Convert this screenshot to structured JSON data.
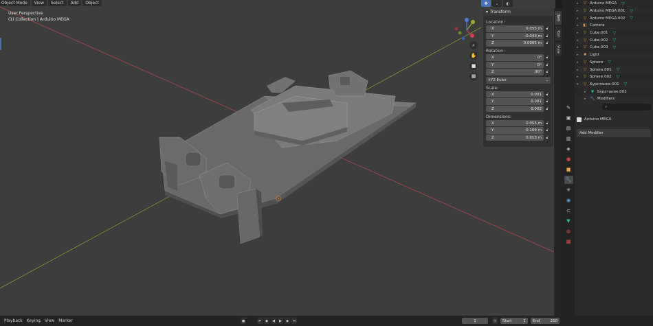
{
  "header": {
    "mode": "Object Mode",
    "menus": [
      "View",
      "Select",
      "Add",
      "Object"
    ]
  },
  "viewport": {
    "perspective": "User Perspective",
    "collection": "(1) Collection | Arduino MEGA"
  },
  "npanel": {
    "title": "Transform",
    "location_label": "Location:",
    "location": [
      {
        "axis": "X",
        "value": "0.055 m"
      },
      {
        "axis": "Y",
        "value": "-0.043 m"
      },
      {
        "axis": "Z",
        "value": "0.0085 m"
      }
    ],
    "rotation_label": "Rotation:",
    "rotation": [
      {
        "axis": "X",
        "value": "0°"
      },
      {
        "axis": "Y",
        "value": "0°"
      },
      {
        "axis": "Z",
        "value": "90°"
      }
    ],
    "rotation_mode": "XYZ Euler",
    "scale_label": "Scale:",
    "scale": [
      {
        "axis": "X",
        "value": "0.001"
      },
      {
        "axis": "Y",
        "value": "0.001"
      },
      {
        "axis": "Z",
        "value": "0.002"
      }
    ],
    "dimensions_label": "Dimensions:",
    "dimensions": [
      {
        "axis": "X",
        "value": "0.055 m"
      },
      {
        "axis": "Y",
        "value": "0.109 m"
      },
      {
        "axis": "Z",
        "value": "0.013 m"
      }
    ]
  },
  "sidetabs": [
    "Item",
    "Tool",
    "View"
  ],
  "outliner": {
    "items": [
      {
        "name": "Arduino MEGA",
        "icon": "object-icon"
      },
      {
        "name": "Arduino MEGA.001",
        "icon": "object-icon"
      },
      {
        "name": "Arduino MEGA.002",
        "icon": "object-icon"
      },
      {
        "name": "Camera",
        "icon": "camera-icon"
      },
      {
        "name": "Cube.001",
        "icon": "object-icon"
      },
      {
        "name": "Cube.002",
        "icon": "object-icon"
      },
      {
        "name": "Cube.003",
        "icon": "object-icon"
      },
      {
        "name": "Light",
        "icon": "light-icon"
      },
      {
        "name": "Sphere",
        "icon": "object-icon"
      },
      {
        "name": "Sphere.001",
        "icon": "object-icon"
      },
      {
        "name": "Sphere.002",
        "icon": "object-icon"
      },
      {
        "name": "Бурстанок.001",
        "icon": "object-icon"
      },
      {
        "name": "Бурстанок.002",
        "icon": "mesh-icon"
      },
      {
        "name": "Modifiers",
        "icon": "wrench-icon"
      }
    ]
  },
  "properties": {
    "object_name": "Arduino MEGA",
    "add_modifier": "Add Modifier"
  },
  "timeline": {
    "menus": [
      "Playback",
      "Keying",
      "View",
      "Marker"
    ],
    "current_frame": "1",
    "start_label": "Start",
    "start": "1",
    "end_label": "End",
    "end": "250"
  },
  "colors": {
    "accent": "#4772b3",
    "x_axis": "#d04050",
    "y_axis": "#8bb43a",
    "mesh_icon": "#2fbf9f",
    "object_icon": "#e8a04a"
  }
}
